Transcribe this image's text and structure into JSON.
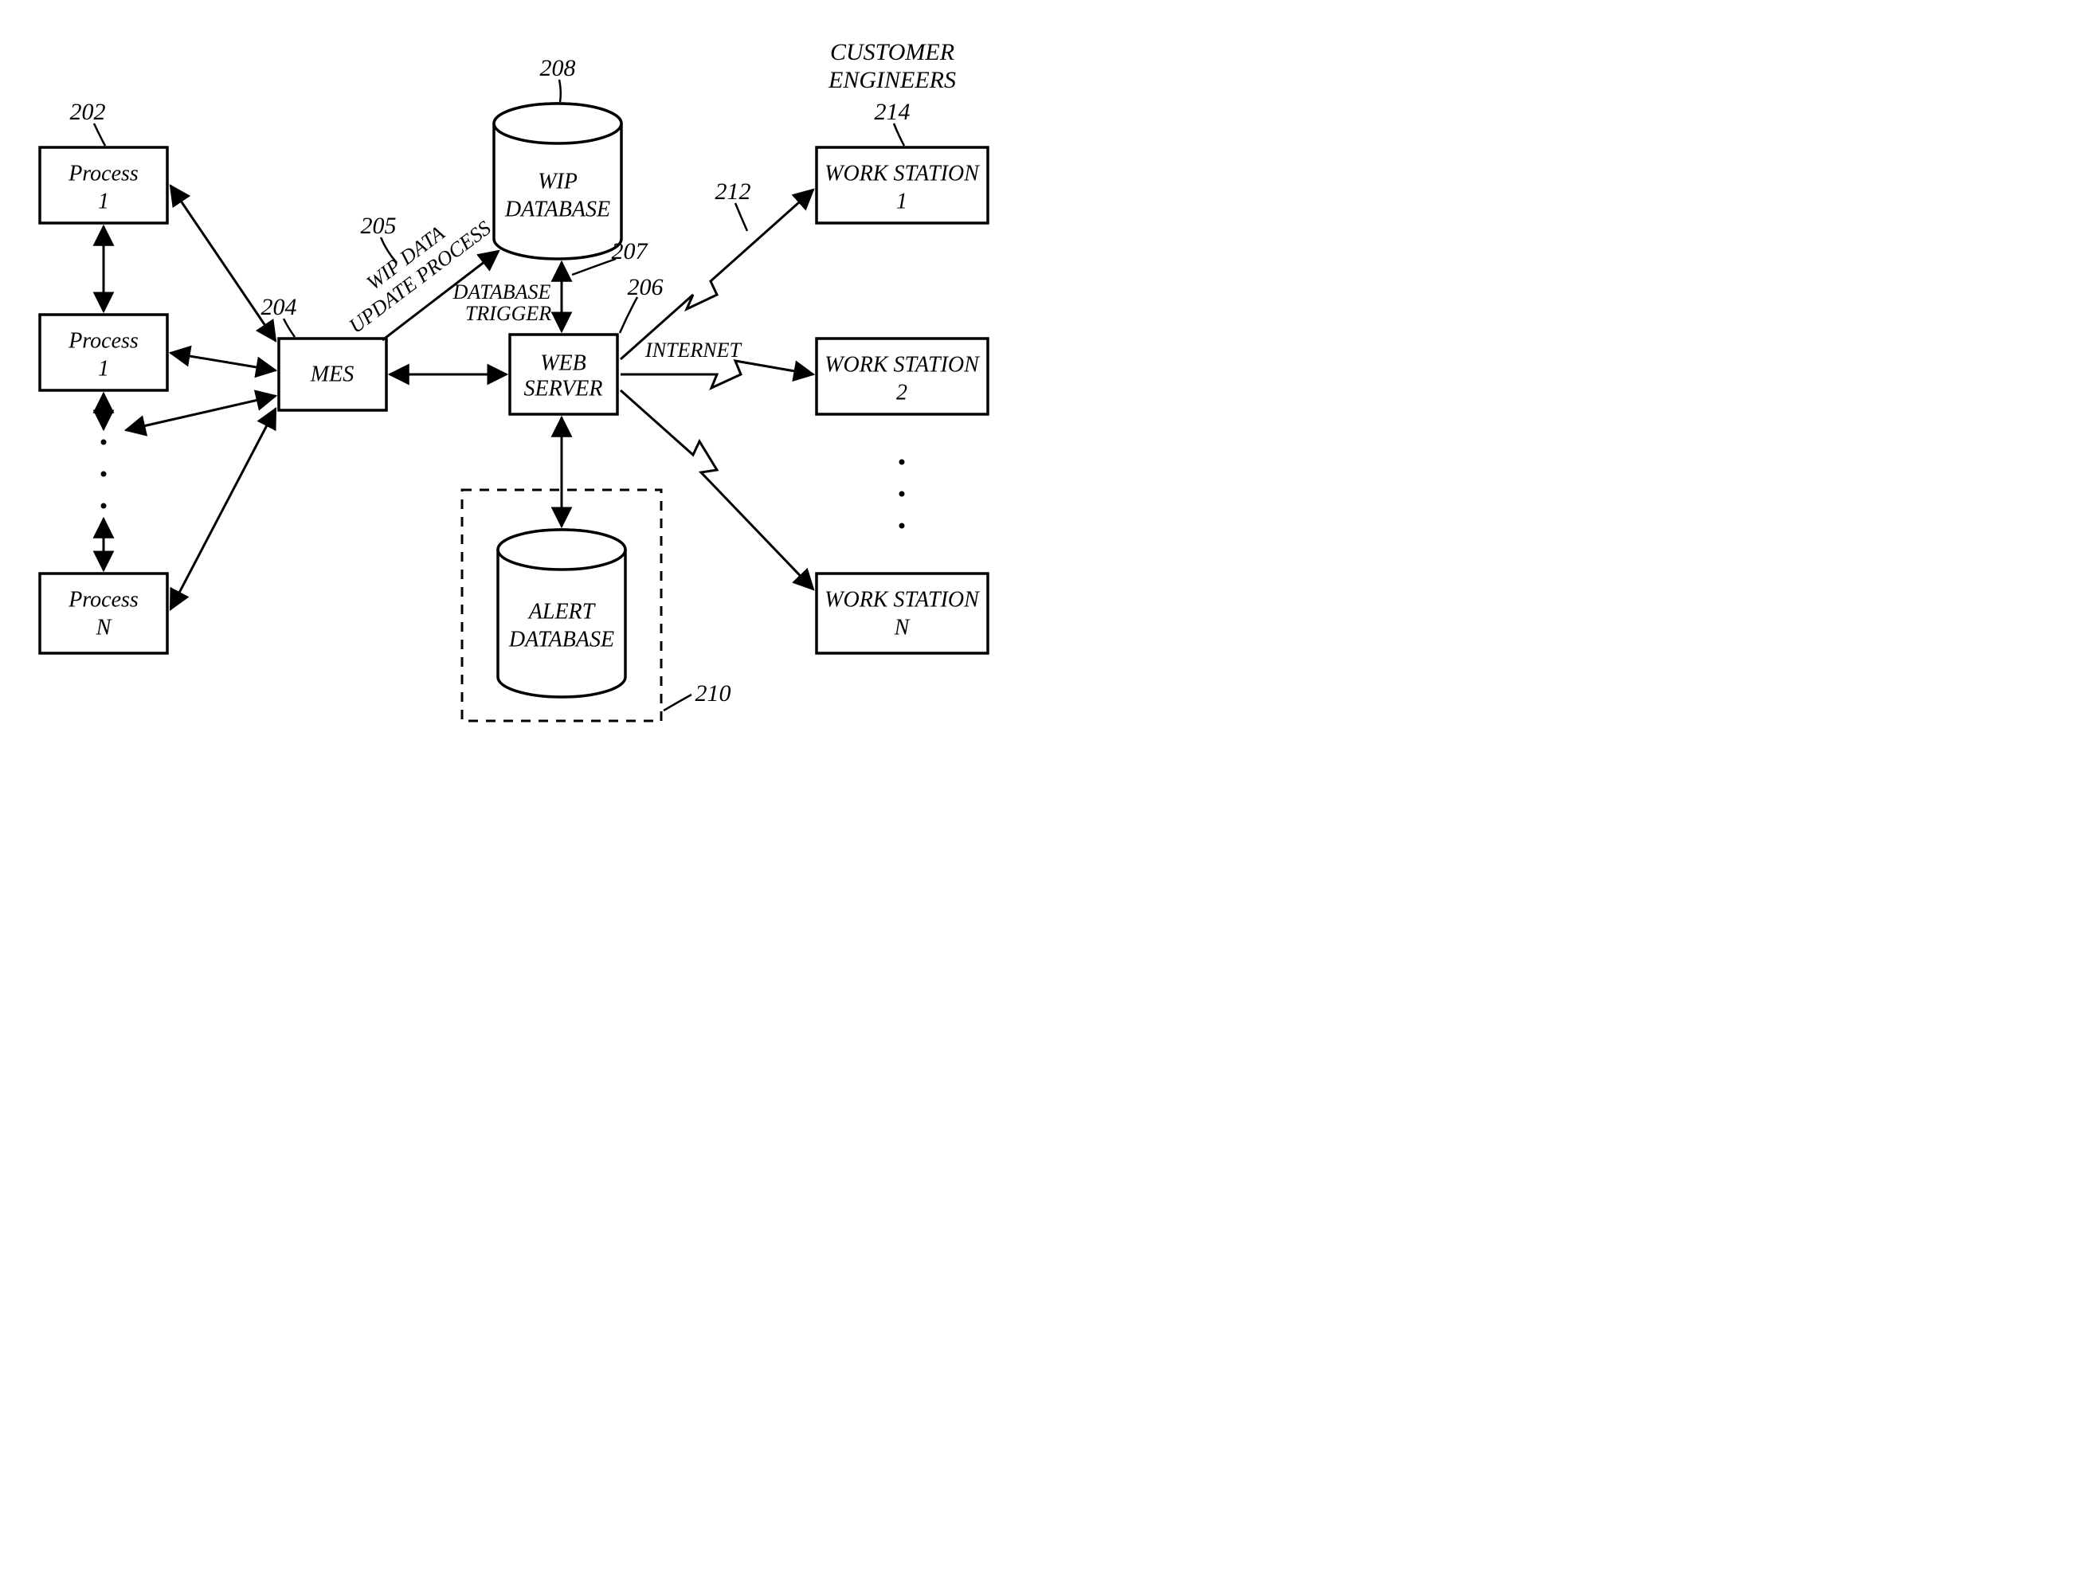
{
  "nodes": {
    "process1": {
      "line1": "Process",
      "line2": "1",
      "ref": "202"
    },
    "process2": {
      "line1": "Process",
      "line2": "1"
    },
    "processN": {
      "line1": "Process",
      "line2": "N"
    },
    "mes": {
      "line1": "MES",
      "ref": "204"
    },
    "wipdb": {
      "line1": "WIP",
      "line2": "DATABASE",
      "ref": "208"
    },
    "webserver": {
      "line1": "WEB",
      "line2": "SERVER",
      "ref": "206"
    },
    "alertdb": {
      "line1": "ALERT",
      "line2": "DATABASE",
      "ref": "210"
    },
    "ws1": {
      "line1": "WORK STATION",
      "line2": "1",
      "ref": "214"
    },
    "ws2": {
      "line1": "WORK STATION",
      "line2": "2"
    },
    "wsN": {
      "line1": "WORK STATION",
      "line2": "N"
    }
  },
  "edges": {
    "wipdata": {
      "label1": "WIP DATA",
      "label2": "UPDATE PROCESS",
      "ref": "205"
    },
    "dbtrigger": {
      "label1": "DATABASE",
      "label2": "TRIGGER",
      "ref": "207"
    },
    "internet": {
      "label": "INTERNET",
      "ref": "212"
    }
  },
  "headings": {
    "customers": {
      "line1": "CUSTOMER",
      "line2": "ENGINEERS"
    }
  }
}
